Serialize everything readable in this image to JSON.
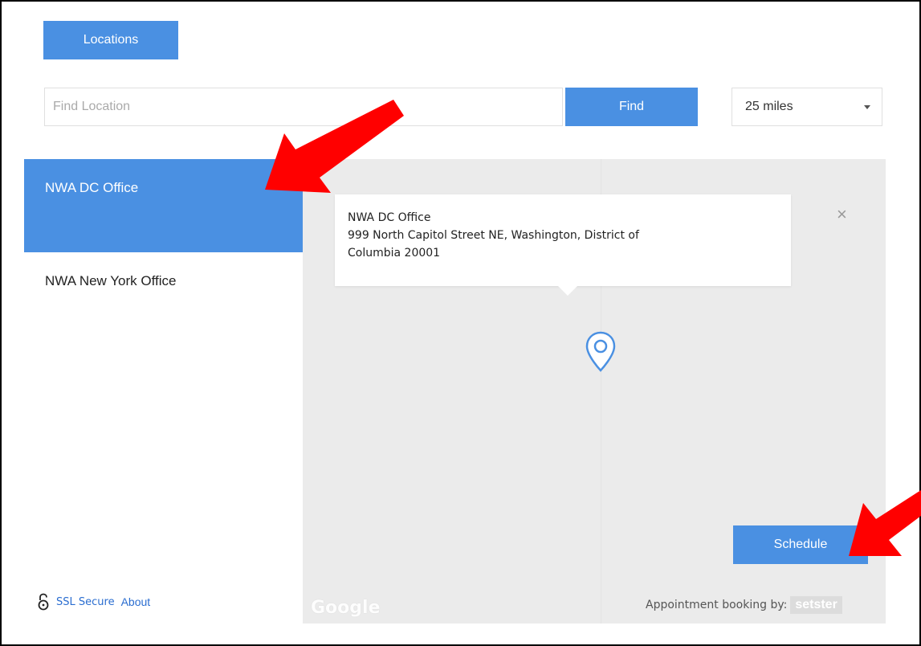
{
  "header": {
    "tab_label": "Locations"
  },
  "search": {
    "placeholder": "Find Location",
    "value": "",
    "find_label": "Find",
    "radius": "25 miles"
  },
  "locations": [
    {
      "name": "NWA DC Office",
      "active": true
    },
    {
      "name": "NWA New York Office",
      "active": false
    }
  ],
  "info_window": {
    "name": "NWA DC Office",
    "address_line1": "999 North Capitol Street NE, Washington, District of",
    "address_line2": "Columbia 20001",
    "close_icon": "close-icon"
  },
  "map": {
    "schedule_label": "Schedule",
    "google_label": "Google",
    "booking_label": "Appointment booking by:",
    "brand_label": "setster",
    "pin_icon": "map-pin-icon"
  },
  "footer": {
    "ssl_label": "SSL Secure",
    "about_label": "About",
    "lock_icon": "lock-open-icon"
  },
  "colors": {
    "accent": "#4a90e2",
    "map_bg": "#ebebeb",
    "arrow": "#ff0000",
    "link": "#2a6dd0"
  }
}
